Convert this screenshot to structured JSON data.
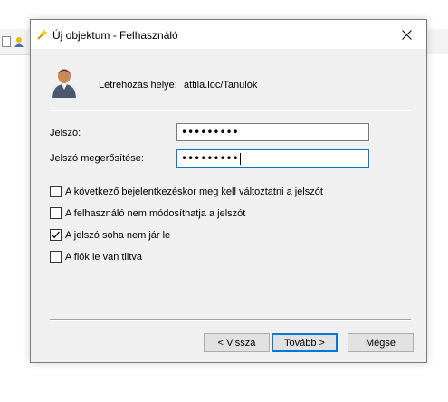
{
  "window": {
    "title": "Új objektum - Felhasználó"
  },
  "header": {
    "location_label": "Létrehozás helye:",
    "location_value": "attila.loc/Tanulók"
  },
  "form": {
    "password_label": "Jelszó:",
    "password_value": "•••••••••",
    "confirm_label": "Jelszó megerősítése:",
    "confirm_value": "•••••••••"
  },
  "options": [
    {
      "label": "A következő bejelentkezéskor meg kell változtatni a jelszót",
      "checked": false
    },
    {
      "label": "A felhasználó nem módosíthatja a jelszót",
      "checked": false
    },
    {
      "label": "A jelszó soha nem jár le",
      "checked": true
    },
    {
      "label": "A fiók le van tiltva",
      "checked": false
    }
  ],
  "buttons": {
    "back": "< Vissza",
    "next": "Tovább >",
    "cancel": "Mégse"
  },
  "colors": {
    "accent": "#0078d7",
    "dialog_bg": "#f0f0f0"
  }
}
